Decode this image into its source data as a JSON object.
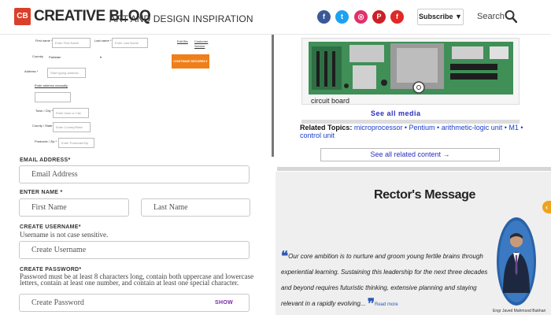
{
  "header": {
    "logo_mark": "CB",
    "logo_text": "CREATIVE BLOQ",
    "tagline": "ART AND DESIGN INSPIRATION",
    "social": [
      {
        "name": "facebook",
        "glyph": "f",
        "color": "#3b5998"
      },
      {
        "name": "twitter",
        "glyph": "t",
        "color": "#1da1f2"
      },
      {
        "name": "instagram",
        "glyph": "◎",
        "color": "#e1306c"
      },
      {
        "name": "pinterest",
        "glyph": "P",
        "color": "#cb2027"
      },
      {
        "name": "flipboard",
        "glyph": "f",
        "color": "#e12828"
      }
    ],
    "subscribe_label": "Subscribe ▼",
    "search_label": "Search"
  },
  "checkout_form": {
    "first_name_label": "First name *",
    "first_name_placeholder": "Enter First Name",
    "last_name_label": "Last name *",
    "last_name_placeholder": "Enter Last Name",
    "edit_link": "Edit Bin",
    "customer_service_link": "Customer Service",
    "country_label": "Country",
    "country_value": "Pakistan",
    "address_label": "Address *",
    "address_placeholder": "Start typing address",
    "enter_manually_link": "Enter address manually",
    "town_label": "Town / City *",
    "town_placeholder": "Enter town or City",
    "county_label": "County / State",
    "county_placeholder": "Enter County/State",
    "postcode_label": "Postcode / Zip *",
    "postcode_placeholder": "Enter Postcode/Zip",
    "continue_label": "CONTINUE SECURELY"
  },
  "media": {
    "caption": "circuit board",
    "see_all_media": "See all media",
    "related_label": "Related Topics:",
    "related_topics": "microprocessor • Pentium • arithmetic-logic unit • M1 • control unit",
    "see_all_related": "See all related content →"
  },
  "signup": {
    "email_label": "EMAIL ADDRESS*",
    "email_placeholder": "Email Address",
    "name_label": "ENTER NAME *",
    "first_placeholder": "First Name",
    "last_placeholder": "Last Name",
    "username_label": "CREATE USERNAME*",
    "username_hint": "Username is not case sensitive.",
    "username_placeholder": "Create Username",
    "password_label": "CREATE PASSWORD*",
    "password_hint": "Password must be at least 8 characters long, contain both uppercase and lowercase letters, contain at least one number, and contain at least one special character.",
    "password_placeholder": "Create Password",
    "show_label": "SHOW"
  },
  "rector": {
    "title": "Rector's Message",
    "quote": "Our core ambition is to nurture and groom young fertile brains through experiential learning. Sustaining this leadership for the next three decades and beyond requires futuristic thinking, extensive planning and staying relevant in a rapidly evolving...",
    "read_more": "Read more",
    "name": "Engr Javed Mahmood Bukhari",
    "tab_glyph": "‹"
  }
}
